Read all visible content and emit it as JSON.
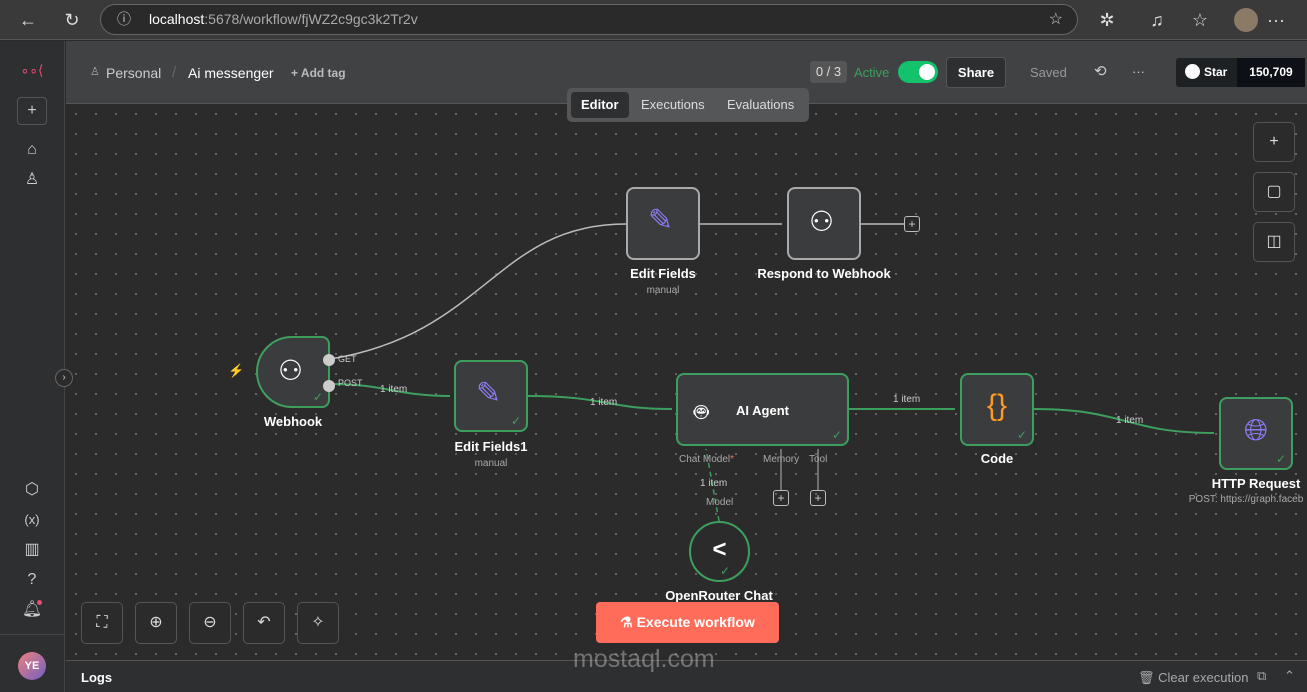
{
  "browser": {
    "url_host": "localhost",
    "url_path": ":5678/workflow/fjWZ2c9gc3k2Tr2v"
  },
  "header": {
    "project": "Personal",
    "separator": "/",
    "workflow_name": "Ai messenger",
    "add_tag": "+ Add tag",
    "counter": "0 / 3",
    "active_label": "Active",
    "active": true,
    "share": "Share",
    "saved": "Saved",
    "more": "···",
    "github_star": "Star",
    "github_count": "150,709"
  },
  "tabs": [
    {
      "label": "Editor",
      "active": true
    },
    {
      "label": "Executions"
    },
    {
      "label": "Evaluations"
    }
  ],
  "nodes": {
    "webhook": {
      "name": "Webhook",
      "out_get": "GET",
      "out_post": "POST"
    },
    "edit_fields1": {
      "name": "Edit Fields1",
      "sub": "manual"
    },
    "edit_fields": {
      "name": "Edit Fields",
      "sub": "manual"
    },
    "respond": {
      "name": "Respond to Webhook"
    },
    "agent": {
      "name": "AI Agent",
      "chat_model": "Chat Model",
      "required": "*",
      "memory": "Memory",
      "tool": "Tool"
    },
    "code": {
      "name": "Code",
      "glyph": "{}"
    },
    "http": {
      "name": "HTTP Request",
      "sub": "POST: https://graph.faceb"
    },
    "openrouter": {
      "name": "OpenRouter Chat",
      "port": "Model"
    }
  },
  "edges": {
    "post_to_edit1": "1 item",
    "edit1_to_agent": "1 item",
    "agent_to_code": "1 item",
    "code_to_http": "1 item",
    "model_to_agent": "1 item"
  },
  "execute_button": "Execute workflow",
  "logs": {
    "title": "Logs",
    "clear": "Clear execution"
  },
  "user": {
    "initials": "YE"
  },
  "watermark": "mostaql.com",
  "colors": {
    "accent": "#ff6d5a",
    "success": "#3d9f5e",
    "toggle": "#13c26b"
  }
}
